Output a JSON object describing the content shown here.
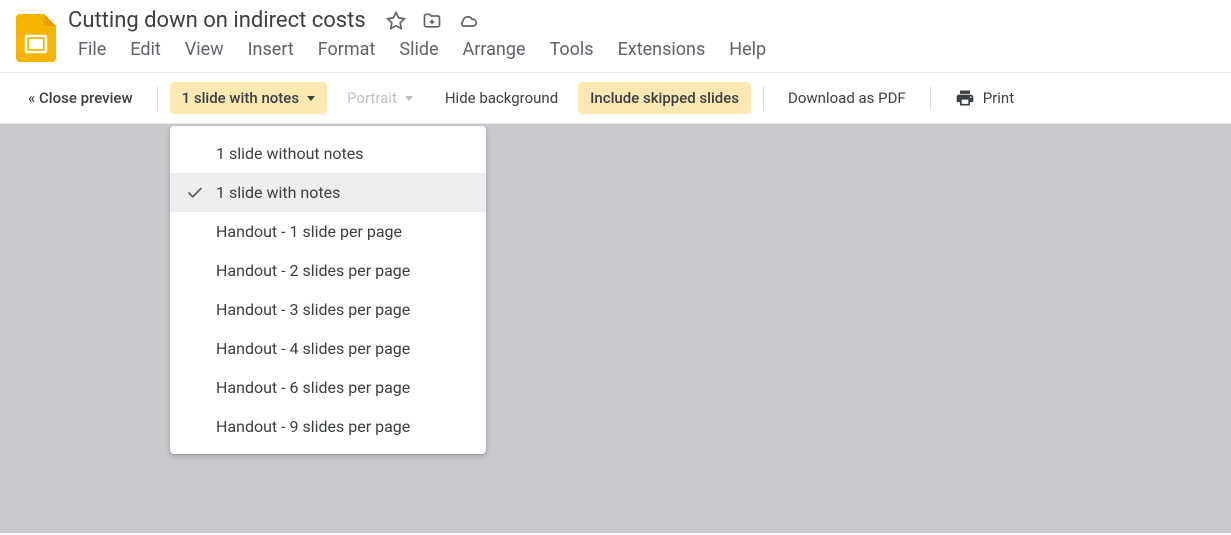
{
  "doc": {
    "title": "Cutting down on indirect costs"
  },
  "menu": {
    "file": "File",
    "edit": "Edit",
    "view": "View",
    "insert": "Insert",
    "format": "Format",
    "slide": "Slide",
    "arrange": "Arrange",
    "tools": "Tools",
    "extensions": "Extensions",
    "help": "Help"
  },
  "toolbar": {
    "close_preview": "« Close preview",
    "layout": "1 slide with notes",
    "orientation": "Portrait",
    "hide_bg": "Hide background",
    "include_skipped": "Include skipped slides",
    "download_pdf": "Download as PDF",
    "print": "Print"
  },
  "dropdown": {
    "options": [
      {
        "label": "1 slide without notes",
        "selected": false
      },
      {
        "label": "1 slide with notes",
        "selected": true
      },
      {
        "label": "Handout - 1 slide per page",
        "selected": false
      },
      {
        "label": "Handout - 2 slides per page",
        "selected": false
      },
      {
        "label": "Handout - 3 slides per page",
        "selected": false
      },
      {
        "label": "Handout - 4 slides per page",
        "selected": false
      },
      {
        "label": "Handout - 6 slides per page",
        "selected": false
      },
      {
        "label": "Handout - 9 slides per page",
        "selected": false
      }
    ]
  }
}
